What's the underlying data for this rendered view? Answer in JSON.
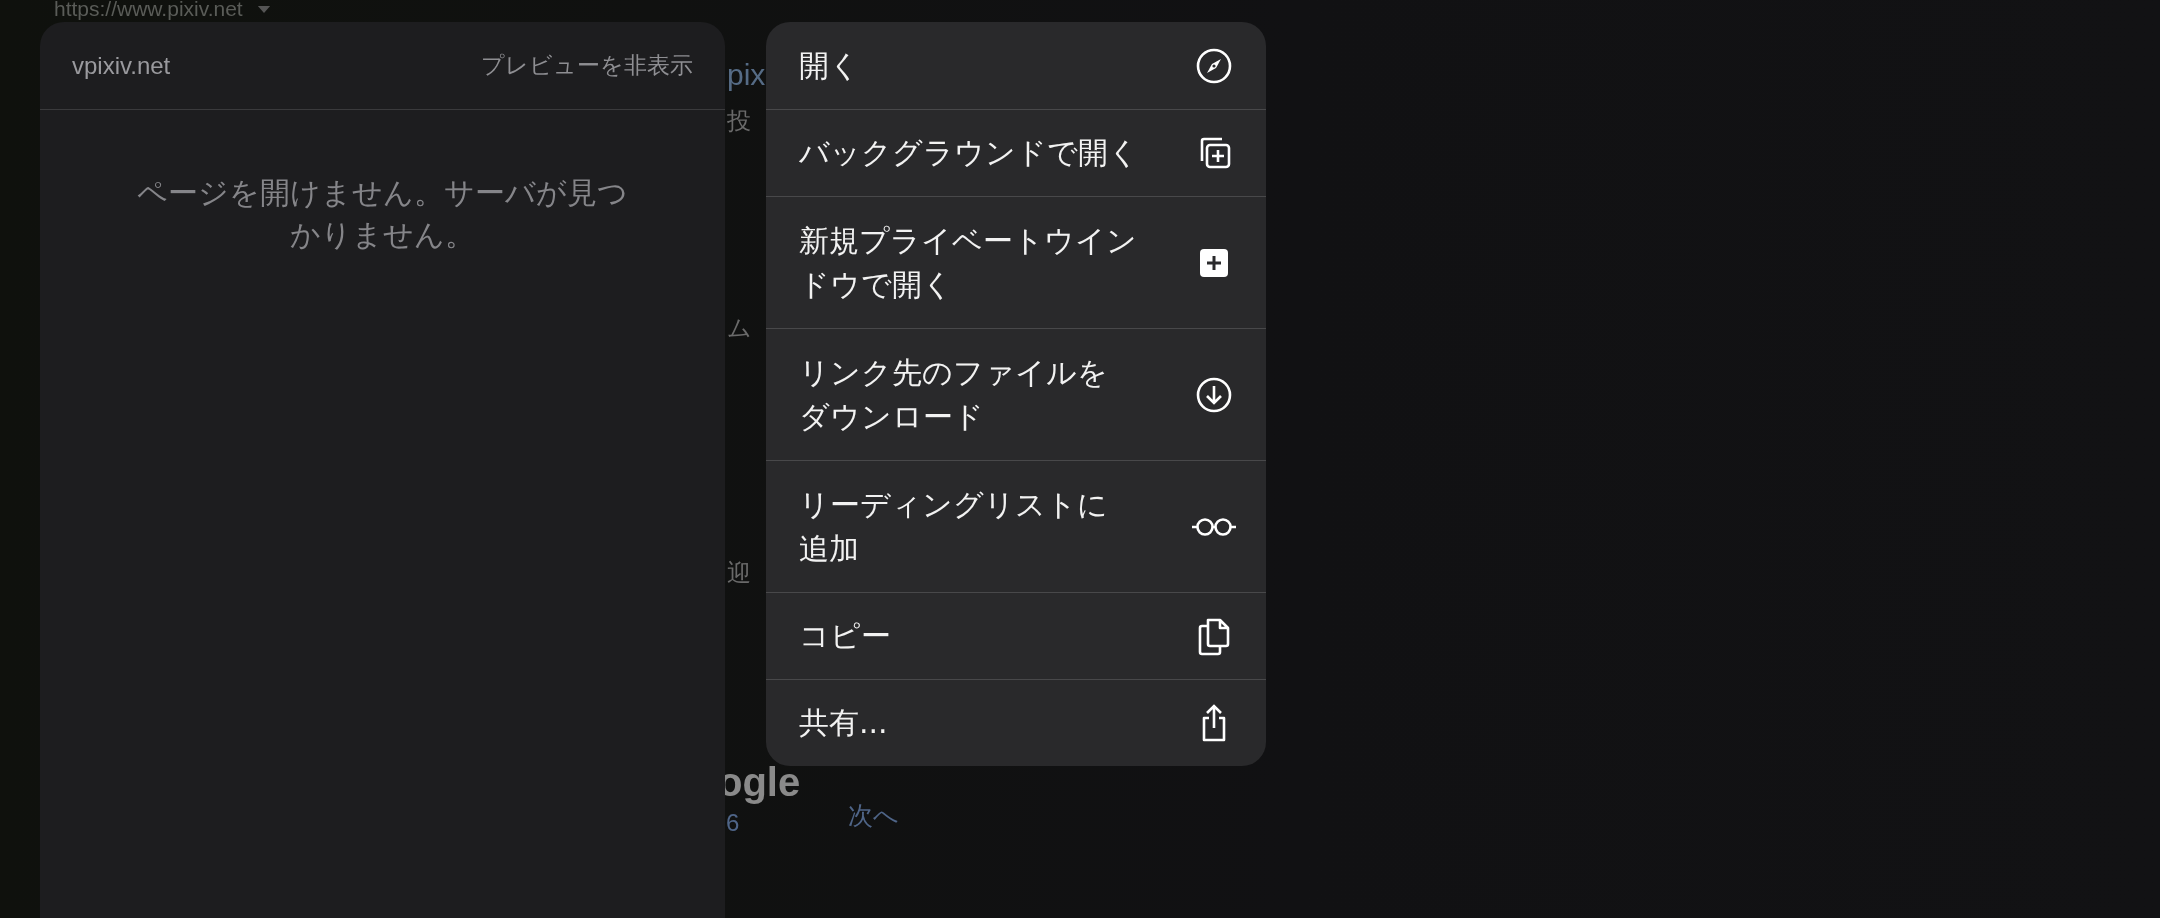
{
  "background": {
    "url": "https://www.pixiv.net",
    "fragments": [
      {
        "kind": "title",
        "text": "pix"
      },
      {
        "kind": "text",
        "text": "投"
      },
      {
        "kind": "text",
        "text": "ム"
      },
      {
        "kind": "text",
        "text": "迎"
      },
      {
        "kind": "logo",
        "text": "ogle"
      },
      {
        "kind": "link",
        "text": "6"
      },
      {
        "kind": "next",
        "text": "次へ"
      }
    ]
  },
  "preview": {
    "domain": "vpixiv.net",
    "hide_label": "プレビューを非表示",
    "message": "ページを開けません。サーバが見つかりません。"
  },
  "menu": [
    {
      "label": "開く"
    },
    {
      "label": "バックグラウンドで開く"
    },
    {
      "label": "新規プライベートウインドウで開く"
    },
    {
      "label": "リンク先のファイルをダウンロード"
    },
    {
      "label": "リーディングリストに追加"
    },
    {
      "label": "コピー"
    },
    {
      "label": "共有..."
    }
  ]
}
